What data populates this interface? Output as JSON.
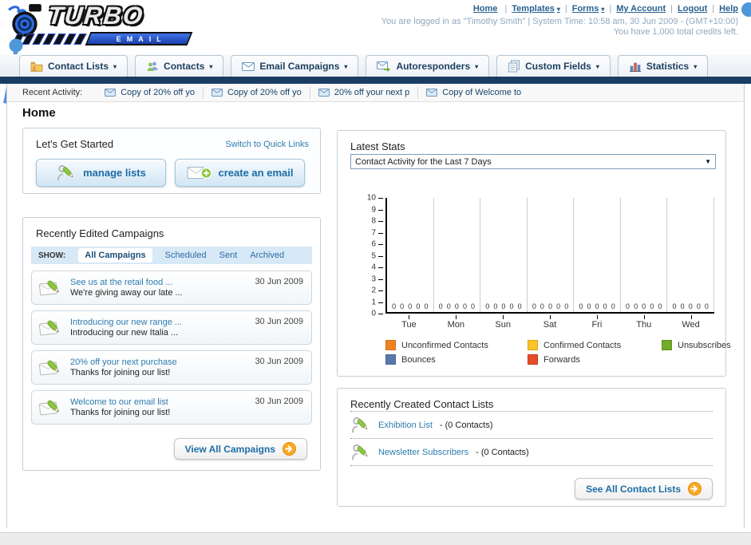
{
  "colors": {
    "navy_bar": "#1b3d63",
    "link_blue": "#2e7cb0",
    "button_text_blue": "#1e6ea6",
    "filter_bar_bg": "#d7e8f6",
    "arrow_circle_orange": "#f9a825",
    "logo_bar_blue": "#2450c8"
  },
  "icons": {
    "caret_down": "▾",
    "dropdown_caret": "▼"
  },
  "header": {
    "logo_title": "TURBO",
    "logo_subtitle": "EMAIL",
    "separator": "|",
    "links": [
      {
        "label": "Home",
        "caret": ""
      },
      {
        "label": "Templates",
        "caret": "▾"
      },
      {
        "label": "Forms",
        "caret": "▾"
      },
      {
        "label": "My Account",
        "caret": ""
      },
      {
        "label": "Logout",
        "caret": ""
      },
      {
        "label": "Help",
        "caret": ""
      }
    ],
    "login_line": "You are logged in as \"Timothy Smith\" | System Time: 10:58 am, 30 Jun 2009 - (GMT+10:00)",
    "credits_line": "You have 1,000 total credits left."
  },
  "nav": {
    "tabs": [
      {
        "label": "Contact Lists"
      },
      {
        "label": "Contacts"
      },
      {
        "label": "Email Campaigns"
      },
      {
        "label": "Autoresponders"
      },
      {
        "label": "Custom Fields"
      },
      {
        "label": "Statistics"
      }
    ]
  },
  "recent_activity": {
    "label": "Recent Activity:",
    "items": [
      "Copy of 20% off yo",
      "Copy of 20% off yo",
      "20% off your next p",
      "Copy of Welcome to"
    ]
  },
  "page_title": "Home",
  "get_started": {
    "title": "Let's Get Started",
    "switch_link": "Switch to Quick Links",
    "manage_lists": "manage lists",
    "create_email": "create an email"
  },
  "campaigns": {
    "title": "Recently Edited Campaigns",
    "show_label": "SHOW:",
    "filters": [
      "All Campaigns",
      "Scheduled",
      "Sent",
      "Archived"
    ],
    "active_filter": "All Campaigns",
    "items": [
      {
        "title": "See us at the retail food ...",
        "subtitle": "We're giving away our late ...",
        "date": "30 Jun 2009"
      },
      {
        "title": "Introducing our new range ...",
        "subtitle": "Introducing our new Italia ...",
        "date": "30 Jun 2009"
      },
      {
        "title": "20% off your next purchase",
        "subtitle": "Thanks for joining our list!",
        "date": "30 Jun 2009"
      },
      {
        "title": "Welcome to our email list",
        "subtitle": "Thanks for joining our list!",
        "date": "30 Jun 2009"
      }
    ],
    "view_all": "View All Campaigns"
  },
  "latest_stats": {
    "title": "Latest Stats",
    "dropdown_value": "Contact Activity for the Last 7 Days"
  },
  "chart_data": {
    "type": "bar",
    "title": "Contact Activity for the Last 7 Days",
    "categories": [
      "Tue",
      "Mon",
      "Sun",
      "Sat",
      "Fri",
      "Thu",
      "Wed"
    ],
    "series": [
      {
        "name": "Unconfirmed Contacts",
        "color": "#f0831f",
        "values": [
          0,
          0,
          0,
          0,
          0,
          0,
          0
        ]
      },
      {
        "name": "Confirmed Contacts",
        "color": "#fcc32a",
        "values": [
          0,
          0,
          0,
          0,
          0,
          0,
          0
        ]
      },
      {
        "name": "Unsubscribes",
        "color": "#73aa28",
        "values": [
          0,
          0,
          0,
          0,
          0,
          0,
          0
        ]
      },
      {
        "name": "Bounces",
        "color": "#5878ac",
        "values": [
          0,
          0,
          0,
          0,
          0,
          0,
          0
        ]
      },
      {
        "name": "Forwards",
        "color": "#e74b28",
        "values": [
          0,
          0,
          0,
          0,
          0,
          0,
          0
        ]
      }
    ],
    "xlabel": "",
    "ylabel": "",
    "ylim": [
      0,
      10
    ],
    "yticks": [
      0,
      1,
      2,
      3,
      4,
      5,
      6,
      7,
      8,
      9,
      10
    ],
    "grid": "vertical",
    "legend_position": "bottom"
  },
  "contact_lists": {
    "title": "Recently Created Contact Lists",
    "items": [
      {
        "name": "Exhibition List",
        "detail": "- (0 Contacts)"
      },
      {
        "name": "Newsletter Subscribers",
        "detail": "- (0 Contacts)"
      }
    ],
    "see_all": "See All Contact Lists"
  }
}
